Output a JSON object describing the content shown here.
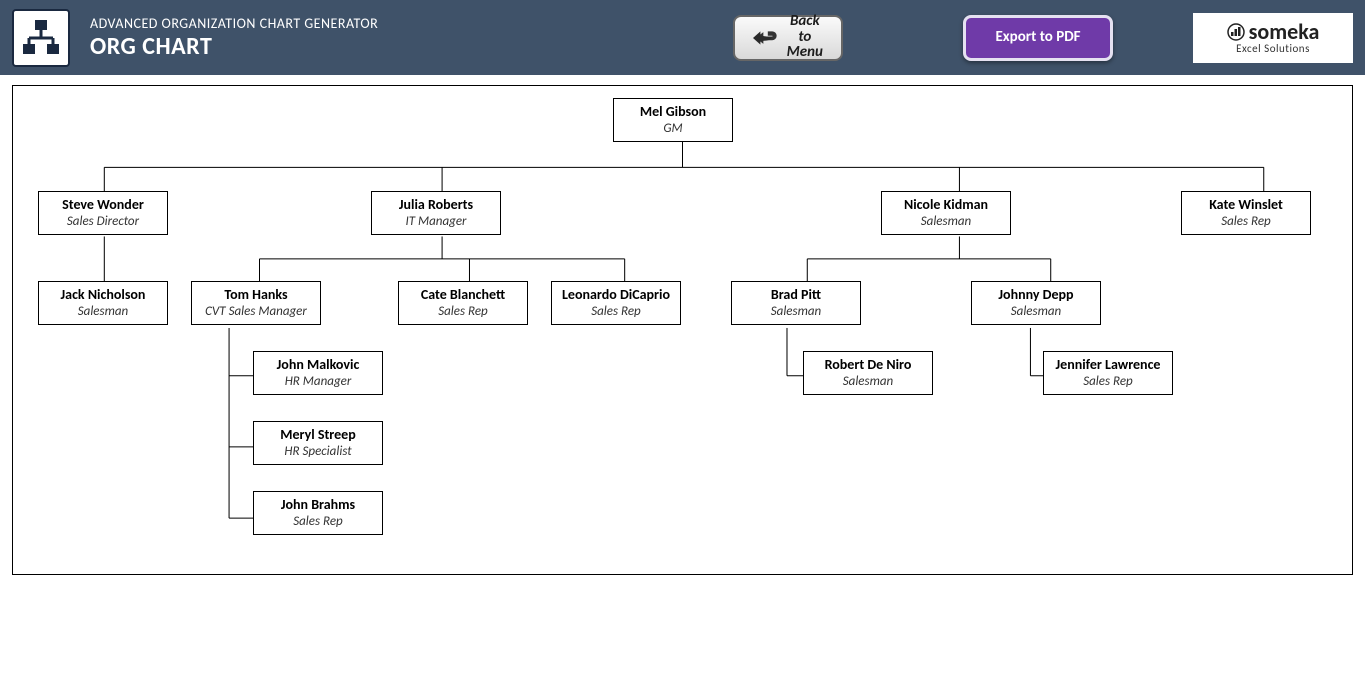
{
  "header": {
    "subtitle": "ADVANCED ORGANIZATION CHART GENERATOR",
    "title": "ORG CHART",
    "back_label": "Back to\nMenu",
    "export_label": "Export to PDF",
    "brand_name": "someka",
    "brand_tag": "Excel Solutions"
  },
  "nodes": {
    "gm": {
      "name": "Mel Gibson",
      "role": "GM"
    },
    "steve": {
      "name": "Steve Wonder",
      "role": "Sales Director"
    },
    "julia": {
      "name": "Julia Roberts",
      "role": "IT Manager"
    },
    "nicole": {
      "name": "Nicole Kidman",
      "role": "Salesman"
    },
    "kate": {
      "name": "Kate Winslet",
      "role": "Sales Rep"
    },
    "jack": {
      "name": "Jack Nicholson",
      "role": "Salesman"
    },
    "tom": {
      "name": "Tom Hanks",
      "role": "CVT Sales Manager"
    },
    "cate": {
      "name": "Cate Blanchett",
      "role": "Sales Rep"
    },
    "leo": {
      "name": "Leonardo DiCaprio",
      "role": "Sales Rep"
    },
    "brad": {
      "name": "Brad Pitt",
      "role": "Salesman"
    },
    "johnny": {
      "name": "Johnny Depp",
      "role": "Salesman"
    },
    "robert": {
      "name": "Robert De Niro",
      "role": "Salesman"
    },
    "jennifer": {
      "name": "Jennifer Lawrence",
      "role": "Sales Rep"
    },
    "john_m": {
      "name": "John Malkovic",
      "role": "HR Manager"
    },
    "meryl": {
      "name": "Meryl Streep",
      "role": "HR Specialist"
    },
    "john_b": {
      "name": "John Brahms",
      "role": "Sales Rep"
    }
  }
}
